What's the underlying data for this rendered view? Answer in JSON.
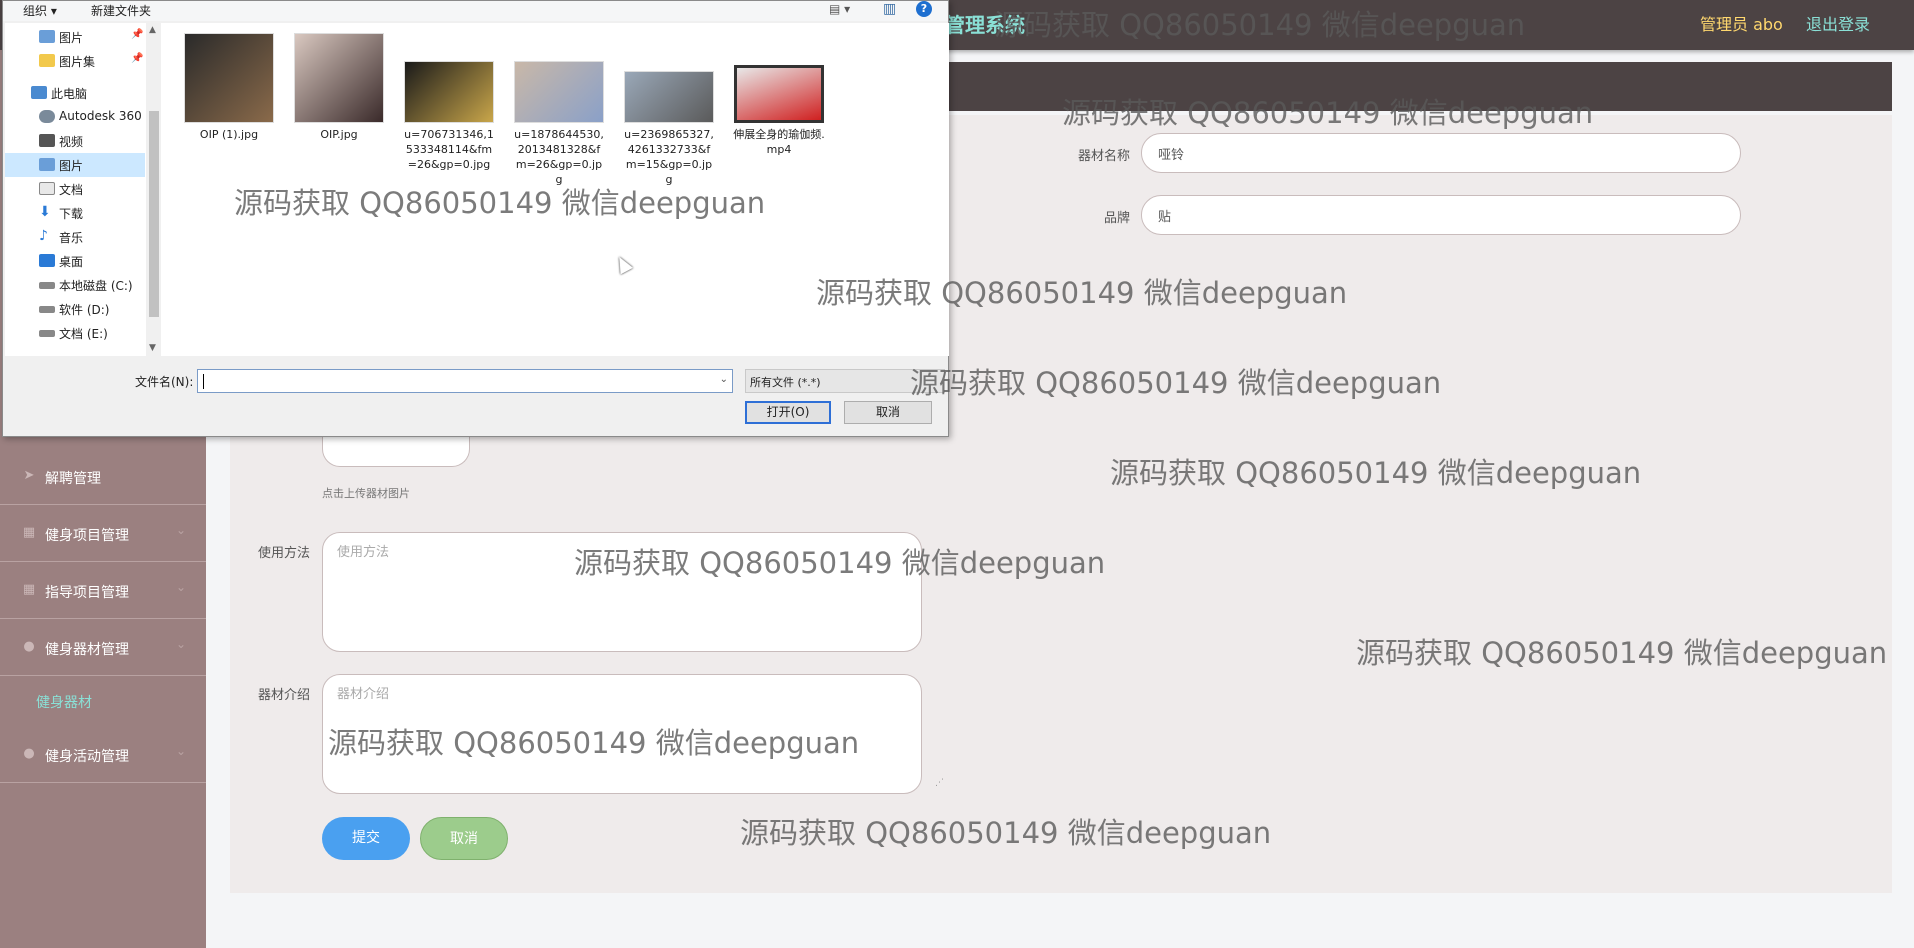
{
  "app": {
    "system_title": "管理系统",
    "user_label": "管理员 abo",
    "logout": "退出登录"
  },
  "sidebar": {
    "items": [
      {
        "label": "解聘管理",
        "icon": "send-icon"
      },
      {
        "label": "健身项目管理",
        "icon": "grid-icon"
      },
      {
        "label": "指导项目管理",
        "icon": "grid-icon"
      },
      {
        "label": "健身器材管理",
        "icon": "user-icon"
      },
      {
        "label": "健身活动管理",
        "icon": "user-icon"
      }
    ],
    "active_sub": "健身器材"
  },
  "form": {
    "name_label": "器材名称",
    "name_value": "哑铃",
    "brand_label": "品牌",
    "brand_value": "贴",
    "upload_hint": "点击上传器材图片",
    "usage_label": "使用方法",
    "usage_placeholder": "使用方法",
    "intro_label": "器材介绍",
    "intro_placeholder": "器材介绍",
    "submit": "提交",
    "cancel": "取消"
  },
  "dialog": {
    "toolbar": {
      "organize": "组织 ▾",
      "new_folder": "新建文件夹",
      "view": "▤ ▾",
      "pane": "▥",
      "help": "?"
    },
    "nav": [
      {
        "label": "图片",
        "icon": "pictures-icon",
        "pinned": true
      },
      {
        "label": "图片集",
        "icon": "folder-icon",
        "pinned": true
      },
      {
        "label": "此电脑",
        "icon": "computer-icon",
        "pinned": false
      },
      {
        "label": "Autodesk 360",
        "icon": "cloud-icon",
        "pinned": false
      },
      {
        "label": "视频",
        "icon": "video-icon",
        "pinned": false
      },
      {
        "label": "图片",
        "icon": "pictures-icon",
        "pinned": false,
        "selected": true
      },
      {
        "label": "文档",
        "icon": "document-icon",
        "pinned": false
      },
      {
        "label": "下载",
        "icon": "download-icon",
        "pinned": false
      },
      {
        "label": "音乐",
        "icon": "music-icon",
        "pinned": false
      },
      {
        "label": "桌面",
        "icon": "desktop-icon",
        "pinned": false
      },
      {
        "label": "本地磁盘 (C:)",
        "icon": "drive-icon",
        "pinned": false
      },
      {
        "label": "软件 (D:)",
        "icon": "drive-icon",
        "pinned": false
      },
      {
        "label": "文档 (E:)",
        "icon": "drive-icon",
        "pinned": false
      }
    ],
    "files": [
      {
        "name": "OIP (1).jpg",
        "thumb_colors": [
          "#2a2a2a",
          "#8a6a4a"
        ]
      },
      {
        "name": "OIP.jpg",
        "thumb_colors": [
          "#d9c8c0",
          "#3a2a2a"
        ]
      },
      {
        "name": "u=706731346,1533348114&fm=26&gp=0.jpg",
        "thumb_colors": [
          "#1a1a1a",
          "#c9a64a"
        ]
      },
      {
        "name": "u=1878644530,2013481328&fm=26&gp=0.jpg",
        "thumb_colors": [
          "#c9b8a8",
          "#8aa0c8"
        ]
      },
      {
        "name": "u=2369865327,4261332733&fm=15&gp=0.jpg",
        "thumb_colors": [
          "#9aa8b8",
          "#5a5a5a"
        ]
      },
      {
        "name": "伸展全身的瑜伽频.mp4",
        "thumb_colors": [
          "#e8e8e8",
          "#d02020"
        ]
      }
    ],
    "filename_label": "文件名(N):",
    "filename_value": "",
    "filetype": "所有文件 (*.*)",
    "open": "打开(O)",
    "cancel": "取消"
  },
  "watermark": "源码获取 QQ86050149 微信deepguan"
}
